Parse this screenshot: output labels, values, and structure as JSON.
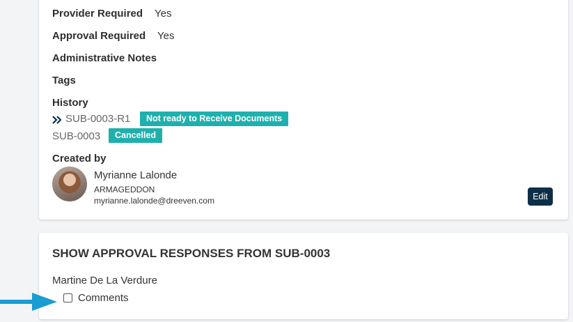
{
  "details": {
    "provider_required_label": "Provider Required",
    "provider_required_value": "Yes",
    "approval_required_label": "Approval Required",
    "approval_required_value": "Yes",
    "admin_notes_label": "Administrative Notes",
    "tags_label": "Tags",
    "history_label": "History"
  },
  "history": [
    {
      "id": "SUB-0003-R1",
      "status": "Not ready to Receive Documents",
      "current": true
    },
    {
      "id": "SUB-0003",
      "status": "Cancelled",
      "current": false
    }
  ],
  "created_by": {
    "label": "Created by",
    "name": "Myrianne Lalonde",
    "org": "ARMAGEDDON",
    "email": "myrianne.lalonde@dreeven.com"
  },
  "edit_label": "Edit",
  "approval_section": {
    "title": "SHOW APPROVAL RESPONSES FROM SUB-0003",
    "approver": "Martine De La Verdure",
    "comments_label": "Comments",
    "comments_checked": false
  },
  "colors": {
    "badge": "#1fb0ad",
    "edit_button": "#0d2f48",
    "annotation_arrow": "#1a9dd1"
  },
  "icons": {
    "history_current": "double-chevron-right-icon",
    "annotation": "arrow-right-icon"
  }
}
